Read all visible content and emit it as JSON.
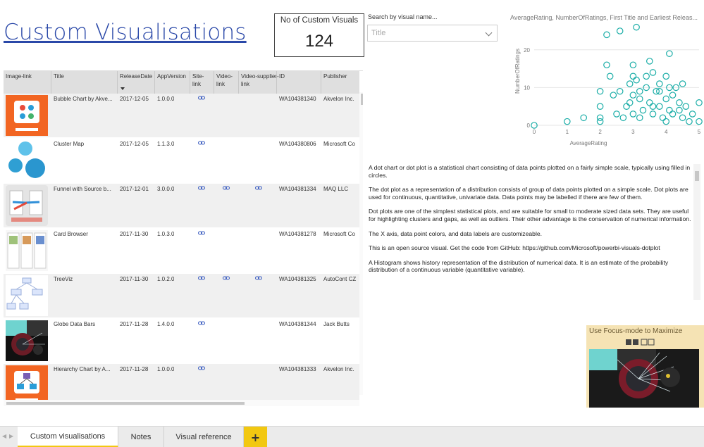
{
  "page_title": "Custom Visualisations",
  "kpi": {
    "label": "No of Custom Visuals",
    "value": "124"
  },
  "search": {
    "label": "Search by visual name...",
    "placeholder": "Title"
  },
  "table": {
    "columns": [
      "Image-link",
      "Title",
      "ReleaseDate",
      "AppVersion",
      "Site-link",
      "Video-link",
      "Video-supplier-link",
      "ID",
      "Publisher"
    ],
    "rows": [
      {
        "title": "Bubble Chart by Akve...",
        "date": "2017-12-05",
        "version": "1.0.0.0",
        "site": true,
        "video": false,
        "supplier": false,
        "id": "WA104381340",
        "publisher": "Akvelon Inc.",
        "thumb": "akvelon-bubble"
      },
      {
        "title": "Cluster Map",
        "date": "2017-12-05",
        "version": "1.1.3.0",
        "site": true,
        "video": false,
        "supplier": false,
        "id": "WA104380806",
        "publisher": "Microsoft Co",
        "thumb": "cluster"
      },
      {
        "title": "Funnel with Source b...",
        "date": "2017-12-01",
        "version": "3.0.0.0",
        "site": true,
        "video": true,
        "supplier": true,
        "id": "WA104381334",
        "publisher": "MAQ LLC",
        "thumb": "maq"
      },
      {
        "title": "Card Browser",
        "date": "2017-11-30",
        "version": "1.0.3.0",
        "site": true,
        "video": false,
        "supplier": false,
        "id": "WA104381278",
        "publisher": "Microsoft Co",
        "thumb": "cards"
      },
      {
        "title": "TreeViz",
        "date": "2017-11-30",
        "version": "1.0.2.0",
        "site": true,
        "video": true,
        "supplier": true,
        "id": "WA104381325",
        "publisher": "AutoCont CZ",
        "thumb": "tree"
      },
      {
        "title": "Globe Data Bars",
        "date": "2017-11-28",
        "version": "1.4.0.0",
        "site": true,
        "video": false,
        "supplier": false,
        "id": "WA104381344",
        "publisher": "Jack Butts",
        "thumb": "globe"
      },
      {
        "title": "Hierarchy Chart by A...",
        "date": "2017-11-28",
        "version": "1.0.0.0",
        "site": true,
        "video": false,
        "supplier": false,
        "id": "WA104381333",
        "publisher": "Akvelon Inc.",
        "thumb": "akvelon-hier"
      }
    ]
  },
  "chart_data": {
    "type": "scatter",
    "title": "AverageRating, NumberOfRatings, First Title and Earliest Releas...",
    "xlabel": "AverageRating",
    "ylabel": "NumberOfRatings",
    "xlim": [
      0,
      5
    ],
    "ylim": [
      0,
      25
    ],
    "xticks": [
      "0",
      "1",
      "2",
      "3",
      "4",
      "5"
    ],
    "yticks": [
      "0",
      "10",
      "20"
    ],
    "color": "#1aada7",
    "points": [
      [
        0,
        0
      ],
      [
        1,
        1
      ],
      [
        1.5,
        2
      ],
      [
        2,
        1
      ],
      [
        2,
        2
      ],
      [
        2,
        5
      ],
      [
        2,
        9
      ],
      [
        2.2,
        16
      ],
      [
        2.3,
        13
      ],
      [
        2.4,
        8
      ],
      [
        2.5,
        3
      ],
      [
        2.6,
        9
      ],
      [
        2.7,
        2
      ],
      [
        2.8,
        5
      ],
      [
        2.9,
        6
      ],
      [
        3,
        3
      ],
      [
        3,
        8
      ],
      [
        3,
        13
      ],
      [
        3,
        16
      ],
      [
        3.1,
        12
      ],
      [
        3.2,
        2
      ],
      [
        3.2,
        7
      ],
      [
        3.3,
        4
      ],
      [
        3.4,
        10
      ],
      [
        3.5,
        17
      ],
      [
        3.5,
        6
      ],
      [
        3.6,
        3
      ],
      [
        3.6,
        14
      ],
      [
        3.7,
        9
      ],
      [
        3.8,
        5
      ],
      [
        3.8,
        11
      ],
      [
        3.9,
        2
      ],
      [
        4,
        1
      ],
      [
        4,
        7
      ],
      [
        4,
        13
      ],
      [
        4.1,
        4
      ],
      [
        4.1,
        19
      ],
      [
        4.2,
        8
      ],
      [
        4.2,
        3
      ],
      [
        4.3,
        10
      ],
      [
        4.4,
        6
      ],
      [
        4.5,
        2
      ],
      [
        4.5,
        11
      ],
      [
        4.6,
        5
      ],
      [
        4.8,
        3
      ],
      [
        5,
        1
      ],
      [
        5,
        6
      ],
      [
        2.2,
        24
      ],
      [
        3.1,
        26
      ],
      [
        2.6,
        25
      ],
      [
        3.4,
        13
      ],
      [
        3.8,
        9
      ],
      [
        4.4,
        4
      ],
      [
        2.9,
        11
      ],
      [
        3.2,
        9
      ],
      [
        4.7,
        1
      ],
      [
        3.6,
        5
      ],
      [
        4.1,
        10
      ]
    ]
  },
  "description": [
    "A dot chart or dot plot is a statistical chart consisting of data points plotted on a fairly simple scale, typically using filled in circles.",
    "The dot plot as a representation of a distribution consists of group of data points plotted on a simple scale. Dot plots are used for continuous, quantitative, univariate data. Data points may be labelled if there are few of them.",
    "Dot plots are one of the simplest statistical plots, and are suitable for small to moderate sized data sets. They are useful for highlighting clusters and gaps, as well as outliers. Their other advantage is the conservation of numerical information.",
    "The X axis, data point colors, and data labels are customizeable.",
    "This is an open source visual. Get the code from GitHub: https://github.com/Microsoft/powerbi-visuals-dotplot",
    "A Histogram shows history representation of the distribution of numerical data. It is an estimate of the probability distribution of a continuous variable (quantitative variable)."
  ],
  "focus": {
    "label": "Use Focus-mode to Maximize"
  },
  "tabs": {
    "items": [
      "Custom visualisations",
      "Notes",
      "Visual reference"
    ],
    "active": 0,
    "add": "+"
  }
}
